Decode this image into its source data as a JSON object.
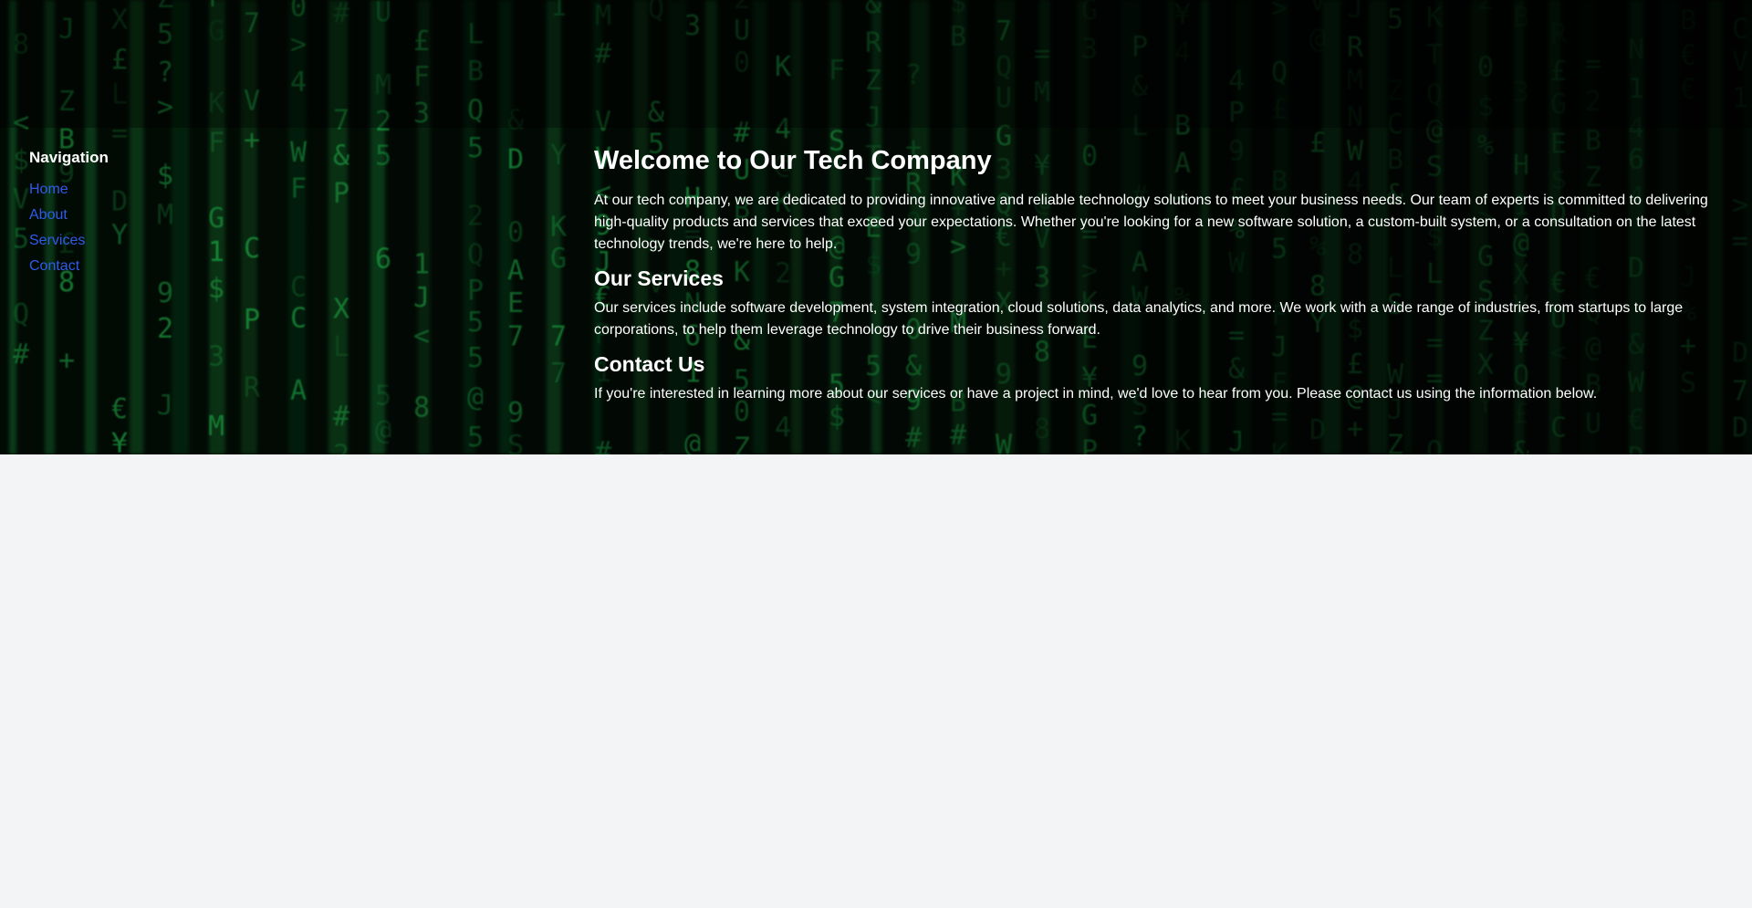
{
  "sidebar": {
    "heading": "Navigation",
    "links": [
      {
        "label": "Home"
      },
      {
        "label": "About"
      },
      {
        "label": "Services"
      },
      {
        "label": "Contact"
      }
    ]
  },
  "main": {
    "title": "Welcome to Our Tech Company",
    "intro": "At our tech company, we are dedicated to providing innovative and reliable technology solutions to meet your business needs. Our team of experts is committed to delivering high-quality products and services that exceed your expectations. Whether you're looking for a new software solution, a custom-built system, or a consultation on the latest technology trends, we're here to help.",
    "services_heading": "Our Services",
    "services_text": "Our services include software development, system integration, cloud solutions, data analytics, and more. We work with a wide range of industries, from startups to large corporations, to help them leverage technology to drive their business forward.",
    "contact_heading": "Contact Us",
    "contact_text": "If you're interested in learning more about our services or have a project in mind, we'd love to hear from you. Please contact us using the information below."
  },
  "colors": {
    "hero_background": "#000000",
    "matrix_green": "#1fbf4f",
    "link": "#2f5bea",
    "page_background": "#f3f4f6"
  }
}
